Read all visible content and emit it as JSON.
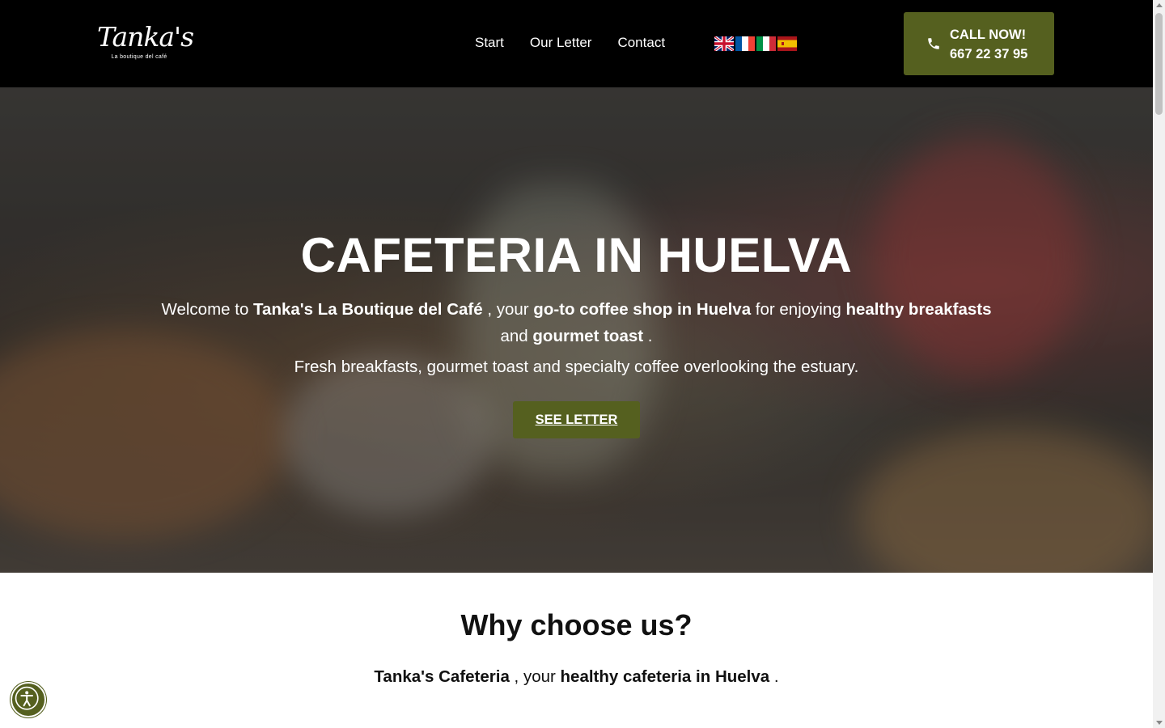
{
  "header": {
    "logo": {
      "script": "Tanka's",
      "tagline": "La boutique del café"
    },
    "nav": [
      {
        "label": "Start"
      },
      {
        "label": "Our Letter"
      },
      {
        "label": "Contact"
      }
    ],
    "languages": [
      {
        "icon": "flag-uk-icon"
      },
      {
        "icon": "flag-fr-icon"
      },
      {
        "icon": "flag-it-icon"
      },
      {
        "icon": "flag-es-icon"
      }
    ],
    "call": {
      "line1": "CALL NOW!",
      "line2": "667 22 37 95",
      "icon": "phone-icon"
    }
  },
  "hero": {
    "title": "CAFETERIA IN HUELVA",
    "intro": {
      "t1": "Welcome to ",
      "b1": "Tanka's La Boutique del Café",
      "t2": " , your ",
      "b2": "go-to coffee shop in Huelva",
      "t3": " for enjoying ",
      "b3": "healthy breakfasts",
      "t4": " and ",
      "b4": "gourmet toast",
      "t5": " ."
    },
    "subtitle": "Fresh breakfasts, gourmet toast and specialty coffee overlooking the estuary.",
    "cta": "SEE LETTER"
  },
  "why": {
    "title": "Why choose us?",
    "line": {
      "b1": "Tanka's Cafeteria",
      "t1": " , your ",
      "b2": "healthy cafeteria in Huelva",
      "t2": " ."
    }
  },
  "colors": {
    "accent": "#55601f",
    "header_bg": "#000000"
  }
}
